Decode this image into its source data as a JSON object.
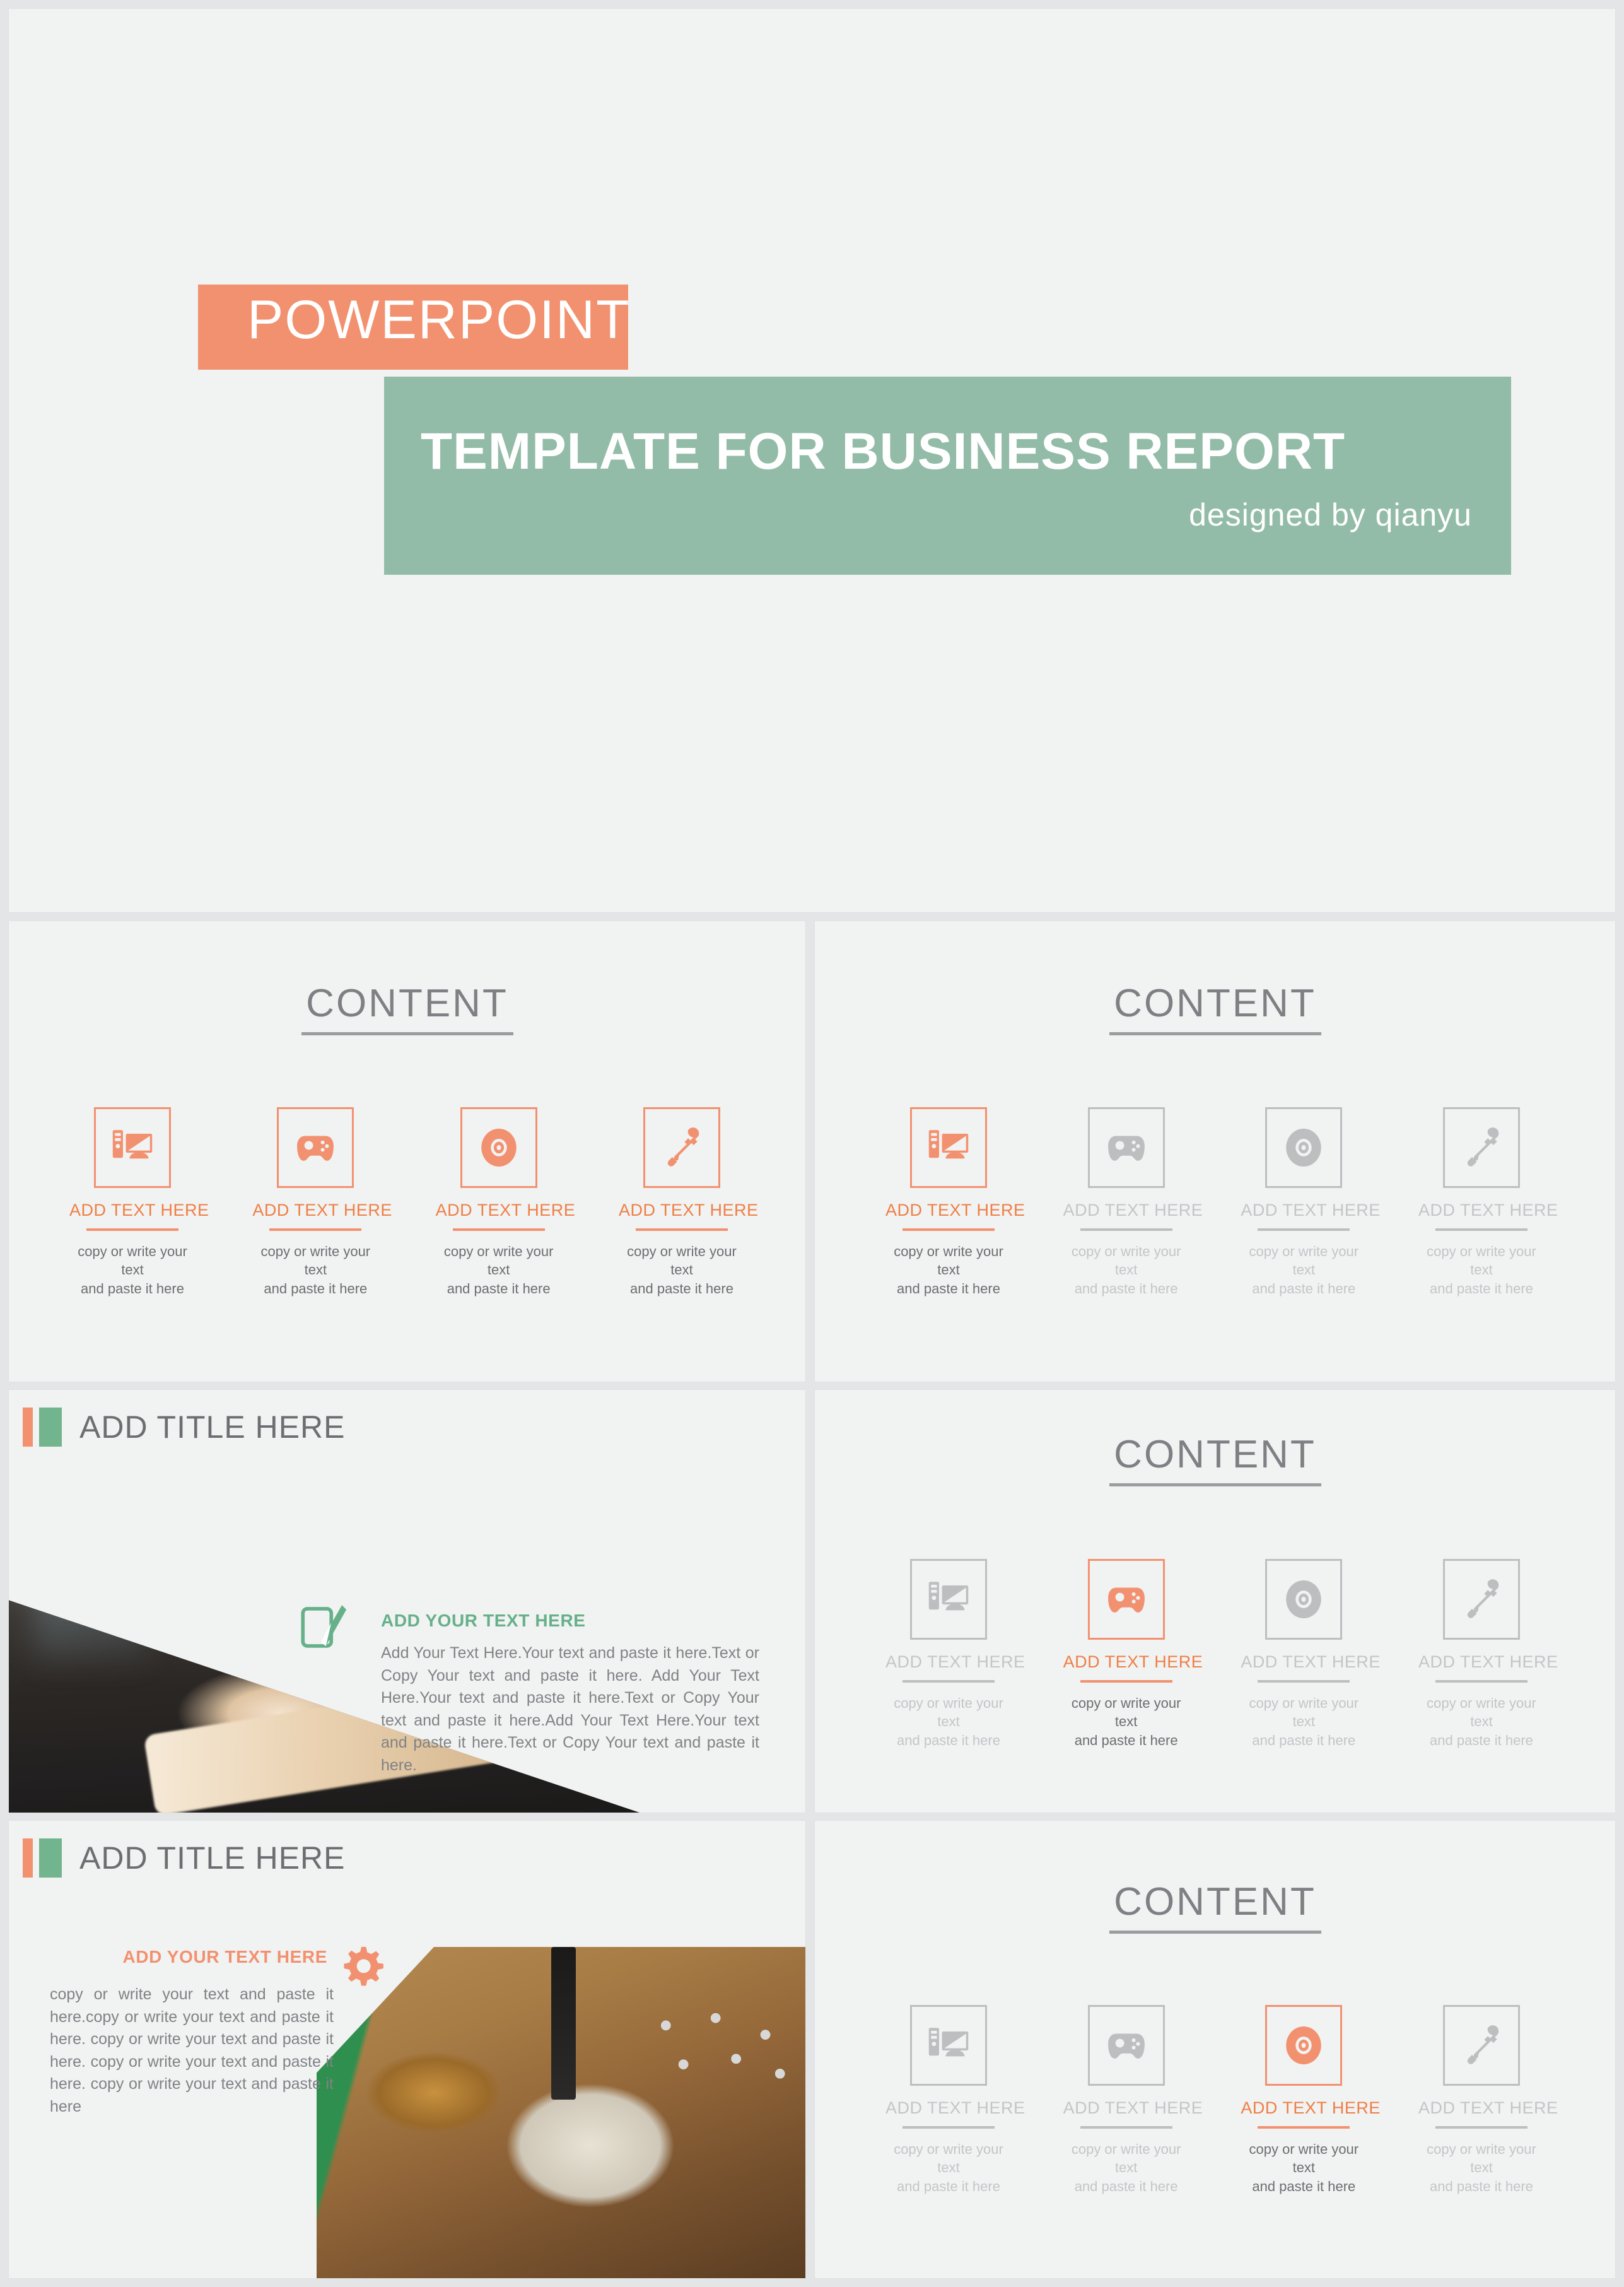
{
  "hero": {
    "eyebrow": "POWERPOINT",
    "title": "TEMPLATE FOR BUSINESS REPORT",
    "subtitle": "designed by qianyu",
    "orange": "#F2916F",
    "green": "#93BCA8"
  },
  "content_title": "CONTENT",
  "cards": {
    "label": "ADD TEXT HERE",
    "desc_line1": "copy or write your text",
    "desc_line2": "and paste it here",
    "icons": [
      "desktop-computer-icon",
      "gamepad-icon",
      "disc-icon",
      "eyedropper-icon"
    ]
  },
  "slides": [
    {
      "name": "title-slide",
      "kind": "hero"
    },
    {
      "name": "content-slide-all-active",
      "kind": "content",
      "active_index": -1,
      "all_active": true
    },
    {
      "name": "content-slide-first-active",
      "kind": "content",
      "active_index": 0,
      "all_active": false
    },
    {
      "name": "text-slide-phone",
      "kind": "text",
      "title": "ADD TITLE HERE",
      "heading": "ADD YOUR TEXT HERE",
      "heading_color": "#66B08A",
      "icon": "note-pen-icon",
      "body": "Add Your Text Here.Your text and paste it here.Text or Copy Your text and paste it here. Add Your Text Here.Your text and paste it here.Text or Copy Your text and paste it here.Add Your Text Here.Your text and paste it here.Text or Copy Your text and paste it here."
    },
    {
      "name": "content-slide-second-active",
      "kind": "content",
      "active_index": 1,
      "all_active": false
    },
    {
      "name": "text-slide-desk",
      "kind": "text",
      "title": "ADD TITLE HERE",
      "heading": "ADD YOUR TEXT HERE",
      "heading_color": "#F2916F",
      "icon": "gear-icon",
      "body": "copy or write your text and paste it here.copy or write your text and paste it here. copy or write your text and paste it here. copy or write your text and paste it here. copy or write your text and paste it here"
    },
    {
      "name": "content-slide-third-active",
      "kind": "content",
      "active_index": 2,
      "all_active": false
    }
  ],
  "labels": {
    "content": "CONTENT",
    "add_title_here": "ADD TITLE HERE",
    "add_your_text_here": "ADD YOUR TEXT HERE",
    "add_text_here": "ADD TEXT HERE",
    "desc_line1": "copy or write your text",
    "desc_line2": "and paste it here",
    "phone_body": "Add Your Text Here.Your text and paste it here.Text or Copy Your text and paste it here. Add Your Text Here.Your text and paste it here.Text or Copy Your text and paste it here.Add Your Text Here.Your text and paste it here.Text or Copy Your text and paste it here.",
    "desk_body": "copy or write your text and paste it here.copy or write your text and paste it here. copy or write your text and paste it here. copy or write your text and paste it here. copy or write your text and paste it here"
  }
}
